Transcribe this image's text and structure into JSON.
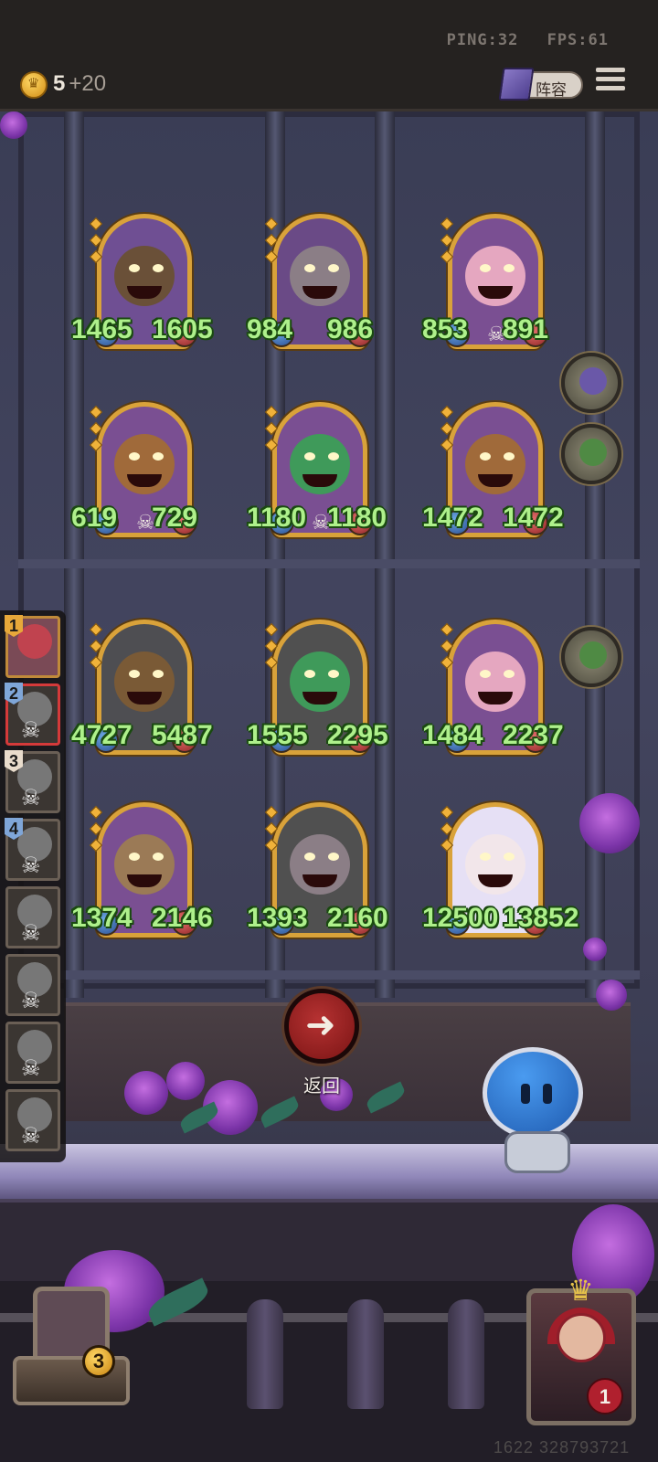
{
  "topbar": {
    "ping_label": "PING:32",
    "fps_label": "FPS:61",
    "gold": "5",
    "gold_income": "+20",
    "lineup_label": "阵容",
    "icons": [
      "coin-icon",
      "lineup-book-icon",
      "menu-icon"
    ]
  },
  "board": {
    "units": [
      {
        "name": "grinning-treant",
        "hp": "1465",
        "atk": "1605",
        "palette": "#6f4f93",
        "face": "#6a5038",
        "row": 0,
        "col": 0,
        "skull": false
      },
      {
        "name": "horned-dragon",
        "hp": "984",
        "atk": "986",
        "palette": "#6a4a86",
        "face": "#8b7e86",
        "row": 0,
        "col": 1,
        "skull": false
      },
      {
        "name": "pink-dryad",
        "hp": "853",
        "atk": "891",
        "palette": "#7a4f92",
        "face": "#e5a7c0",
        "row": 0,
        "col": 2,
        "skull": true
      },
      {
        "name": "pumpkin-monster",
        "hp": "619",
        "atk": "729",
        "palette": "#7a4f92",
        "face": "#a06a3a",
        "row": 1,
        "col": 0,
        "skull": true
      },
      {
        "name": "cactus-goblin",
        "hp": "1180",
        "atk": "1180",
        "palette": "#7a4f92",
        "face": "#3f9a5a",
        "row": 1,
        "col": 1,
        "skull": true
      },
      {
        "name": "pumpkin-monster",
        "hp": "1472",
        "atk": "1472",
        "palette": "#7a4f92",
        "face": "#a06a3a",
        "row": 1,
        "col": 2,
        "skull": false
      },
      {
        "name": "pumpkin-monster",
        "hp": "4727",
        "atk": "5487",
        "palette": "#4e4e52",
        "face": "#7a5a36",
        "row": 2,
        "col": 0,
        "skull": false
      },
      {
        "name": "cactus-goblin",
        "hp": "1555",
        "atk": "2295",
        "palette": "#505050",
        "face": "#3f9a5a",
        "row": 2,
        "col": 1,
        "skull": false
      },
      {
        "name": "pink-dryad",
        "hp": "1484",
        "atk": "2237",
        "palette": "#7a4f92",
        "face": "#e5a7c0",
        "row": 2,
        "col": 2,
        "skull": false
      },
      {
        "name": "autumn-ent",
        "hp": "1374",
        "atk": "2146",
        "palette": "#7a4f92",
        "face": "#9b7a56",
        "row": 3,
        "col": 0,
        "skull": false
      },
      {
        "name": "horned-dragon",
        "hp": "1393",
        "atk": "2160",
        "palette": "#505050",
        "face": "#8b7e86",
        "row": 3,
        "col": 1,
        "skull": false
      },
      {
        "name": "bride-queen",
        "hp": "12500",
        "atk": "13852",
        "palette": "#e6e0f5",
        "face": "#f2e6ea",
        "row": 3,
        "col": 2,
        "skull": false
      }
    ]
  },
  "roster": {
    "players": [
      {
        "number": "1",
        "state": "active",
        "color": "#e7a83a"
      },
      {
        "number": "2",
        "state": "selected",
        "color": "#7fa6d8"
      },
      {
        "number": "3",
        "state": "dead",
        "color": "#e9dccc"
      },
      {
        "number": "4",
        "state": "dead",
        "color": "#7fa6d8"
      },
      {
        "number": "",
        "state": "dead",
        "color": ""
      },
      {
        "number": "",
        "state": "dead",
        "color": ""
      },
      {
        "number": "",
        "state": "dead",
        "color": ""
      },
      {
        "number": "",
        "state": "dead",
        "color": ""
      }
    ]
  },
  "return_button": {
    "label": "返回"
  },
  "shop": {
    "count": "3"
  },
  "hero": {
    "lives": "1"
  },
  "footer": {
    "version_text": "1622 328793721"
  }
}
